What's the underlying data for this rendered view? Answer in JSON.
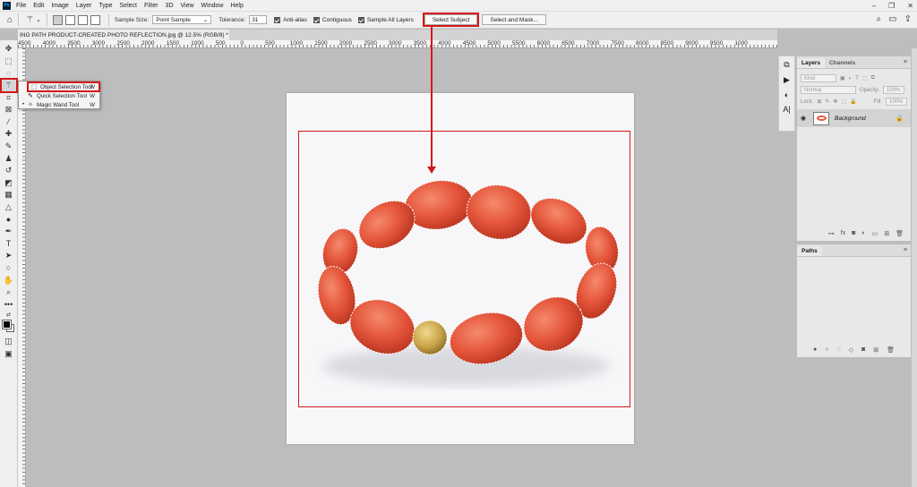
{
  "menubar": {
    "logo": "Ps",
    "items": [
      "File",
      "Edit",
      "Image",
      "Layer",
      "Type",
      "Select",
      "Filter",
      "3D",
      "View",
      "Window",
      "Help"
    ],
    "window_controls": [
      "–",
      "❐",
      "✕"
    ]
  },
  "options": {
    "sample_size_label": "Sample Size:",
    "sample_size_value": "Point Sample",
    "tolerance_label": "Tolerance:",
    "tolerance_value": "31",
    "anti_alias": "Anti-alias",
    "contiguous": "Contiguous",
    "sample_all_layers": "Sample All Layers",
    "select_subject": "Select Subject",
    "select_and_mask": "Select and Mask..."
  },
  "document": {
    "tab_title": "ING PATH PRODUCT-CREATED PHOTO REFLECTION.jpg @ 12.5% (RGB/8) *",
    "close": "×"
  },
  "ruler": {
    "labels": [
      "4500",
      "4000",
      "3500",
      "3000",
      "2500",
      "2000",
      "1500",
      "1000",
      "500",
      "0",
      "500",
      "1000",
      "1500",
      "2000",
      "2500",
      "3000",
      "3500",
      "4000",
      "4500",
      "5000",
      "5500",
      "6000",
      "6500",
      "7000",
      "7500",
      "8000",
      "8500",
      "9000",
      "9500",
      "1000"
    ]
  },
  "flyout": {
    "items": [
      {
        "label": "Object Selection Tool",
        "key": "W",
        "icon": "object-select-icon",
        "glyph": "⬚",
        "bullet": ""
      },
      {
        "label": "Quick Selection Tool",
        "key": "W",
        "icon": "quick-select-icon",
        "glyph": "✎",
        "bullet": ""
      },
      {
        "label": "Magic Wand Tool",
        "key": "W",
        "icon": "magic-wand-icon",
        "glyph": "✧",
        "bullet": "•"
      }
    ]
  },
  "layers_panel": {
    "tabs": [
      "Layers",
      "Channels"
    ],
    "kind_placeholder": "Kind",
    "blend_mode": "Normal",
    "opacity_label": "Opacity:",
    "opacity_value": "100%",
    "lock_label": "Lock:",
    "fill_label": "Fill:",
    "fill_value": "100%",
    "layer_name": "Background"
  },
  "paths_panel": {
    "title": "Paths"
  },
  "colors": {
    "annotation": "#d11a1a",
    "bead": "#e4553a",
    "gold": "#c9a44a"
  }
}
